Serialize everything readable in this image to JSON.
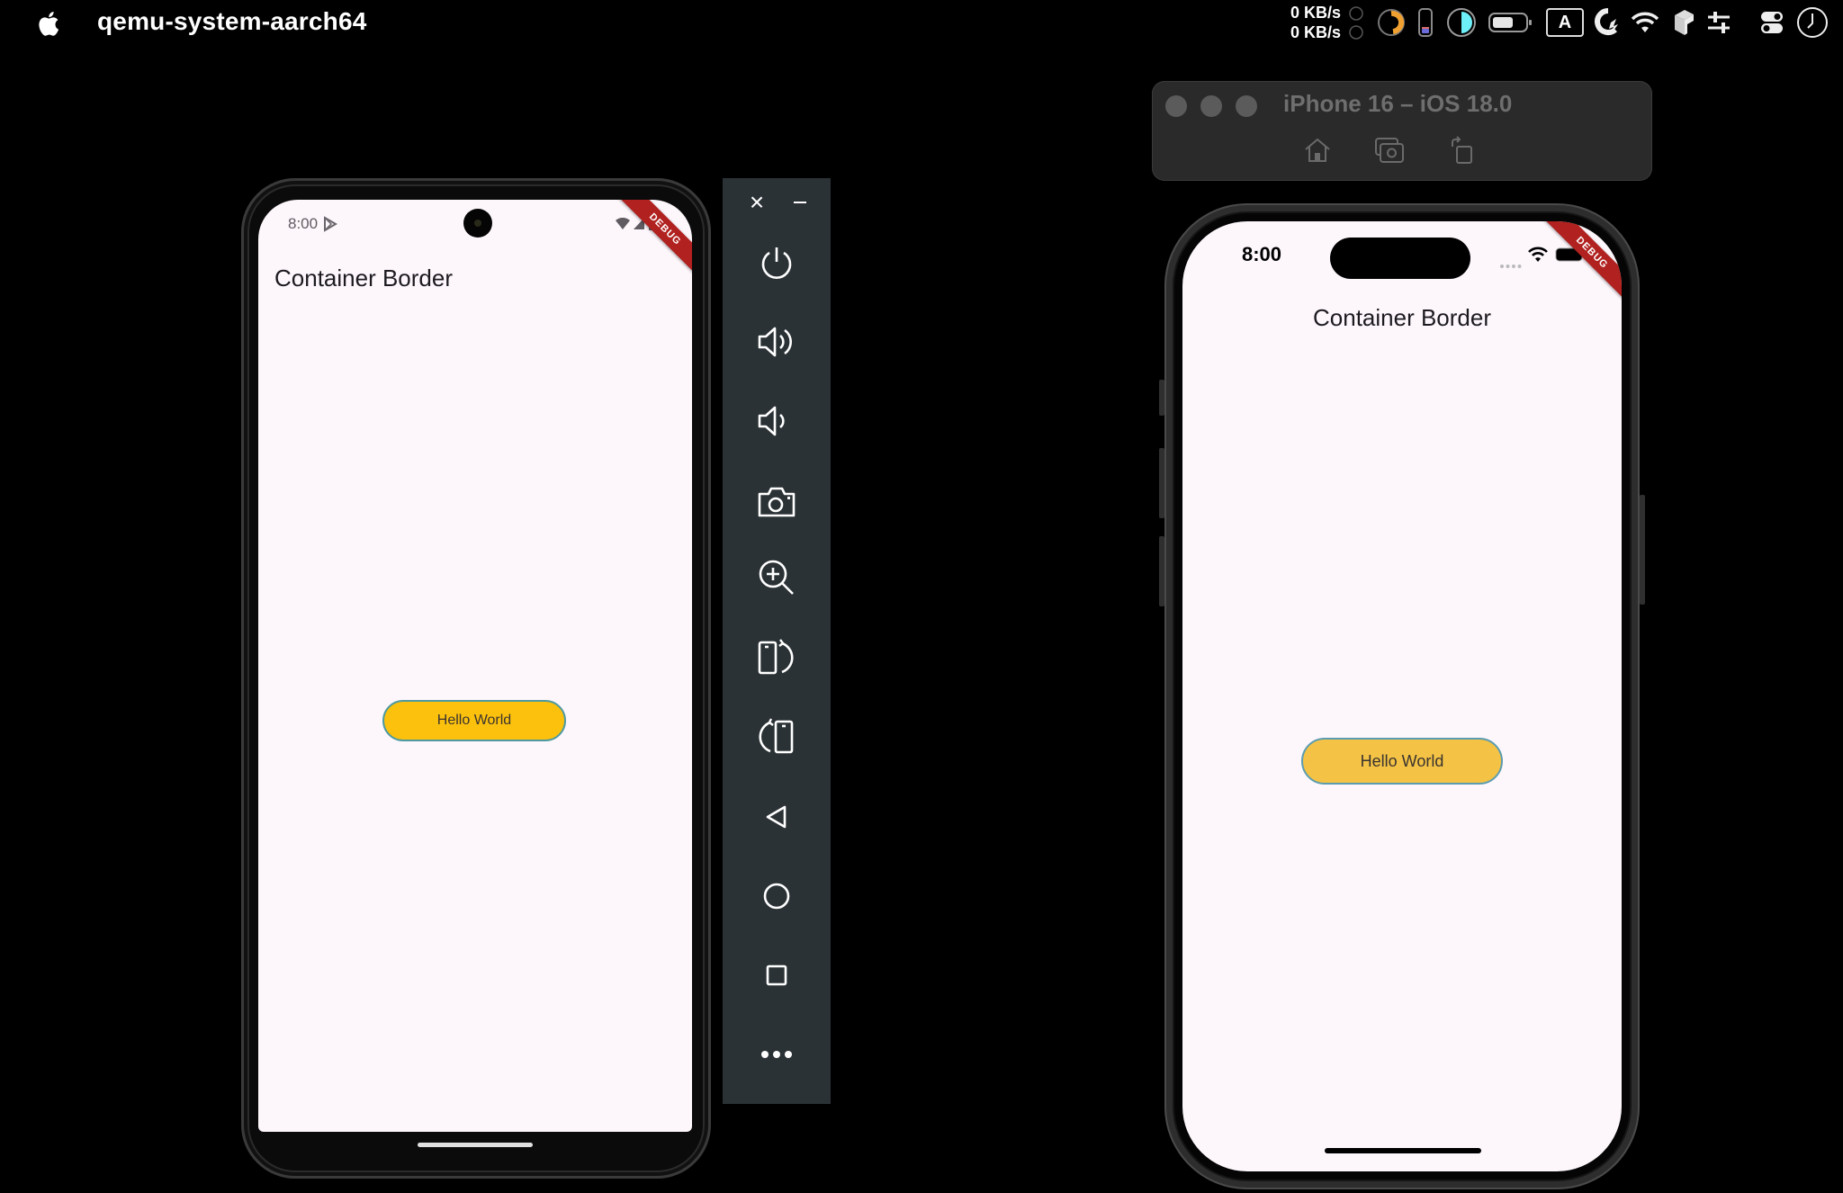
{
  "menubar": {
    "app_name": "qemu-system-aarch64",
    "network": {
      "upload": "0 KB/s",
      "download": "0 KB/s"
    },
    "tray_icons": [
      "activity-ring-icon",
      "phone-battery-icon",
      "half-moon-icon",
      "battery-icon",
      "input-source-icon",
      "quick-action-icon",
      "wifi-icon",
      "cube-icon",
      "sliders-icon",
      "control-center-icon",
      "clock-icon"
    ],
    "input_source_label": "A"
  },
  "android": {
    "status_time": "8:00",
    "app_title": "Container Border",
    "button_label": "Hello World",
    "debug_banner": "DEBUG",
    "colors": {
      "button_fill": "#fcc10d",
      "button_border": "#4e9aa0",
      "background": "#fdf7fc"
    }
  },
  "emulator_toolbar": {
    "close_label": "×",
    "minimize_label": "–",
    "buttons": [
      {
        "name": "power",
        "icon": "power-icon"
      },
      {
        "name": "volume-up",
        "icon": "volume-up-icon"
      },
      {
        "name": "volume-down",
        "icon": "volume-down-icon"
      },
      {
        "name": "screenshot",
        "icon": "camera-icon"
      },
      {
        "name": "zoom",
        "icon": "zoom-in-icon"
      },
      {
        "name": "rotate-left",
        "icon": "rotate-left-icon"
      },
      {
        "name": "rotate-right",
        "icon": "rotate-right-icon"
      },
      {
        "name": "back",
        "icon": "back-triangle-icon"
      },
      {
        "name": "home",
        "icon": "home-circle-icon"
      },
      {
        "name": "overview",
        "icon": "overview-square-icon"
      },
      {
        "name": "more",
        "icon": "more-dots-icon"
      }
    ]
  },
  "ios_simulator": {
    "window_title": "iPhone 16 – iOS 18.0",
    "toolbar": [
      "home",
      "screenshot",
      "rotate"
    ],
    "status_time": "8:00",
    "app_title": "Container Border",
    "button_label": "Hello World",
    "debug_banner": "DEBUG",
    "colors": {
      "button_fill": "#f4c345",
      "button_border": "#5c9cb0",
      "background": "#fdf7fc"
    }
  }
}
